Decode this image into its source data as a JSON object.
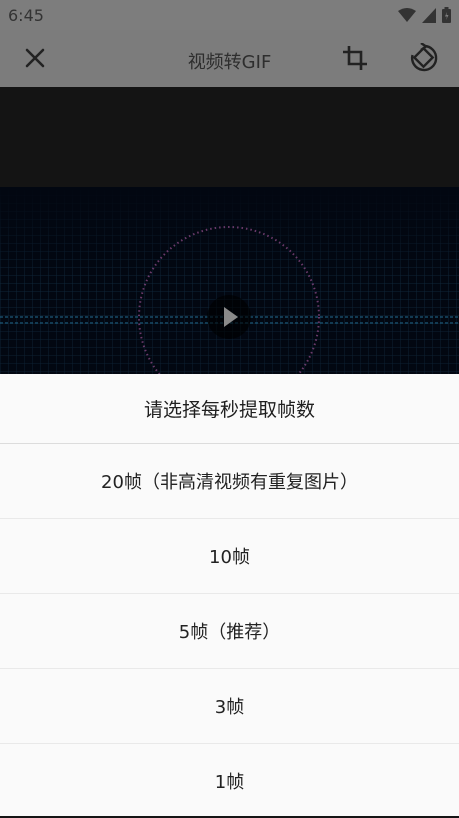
{
  "status_bar": {
    "time": "6:45",
    "icons": [
      "wifi-icon",
      "signal-icon",
      "battery-icon"
    ]
  },
  "app_bar": {
    "title": "视频转GIF",
    "icons": [
      "close-icon",
      "crop-icon",
      "rotate-icon"
    ]
  },
  "video": {
    "play_icon": "play-icon"
  },
  "sheet": {
    "title": "请选择每秒提取帧数",
    "options": [
      "20帧（非高清视频有重复图片）",
      "10帧",
      "5帧（推荐）",
      "3帧",
      "1帧"
    ]
  }
}
